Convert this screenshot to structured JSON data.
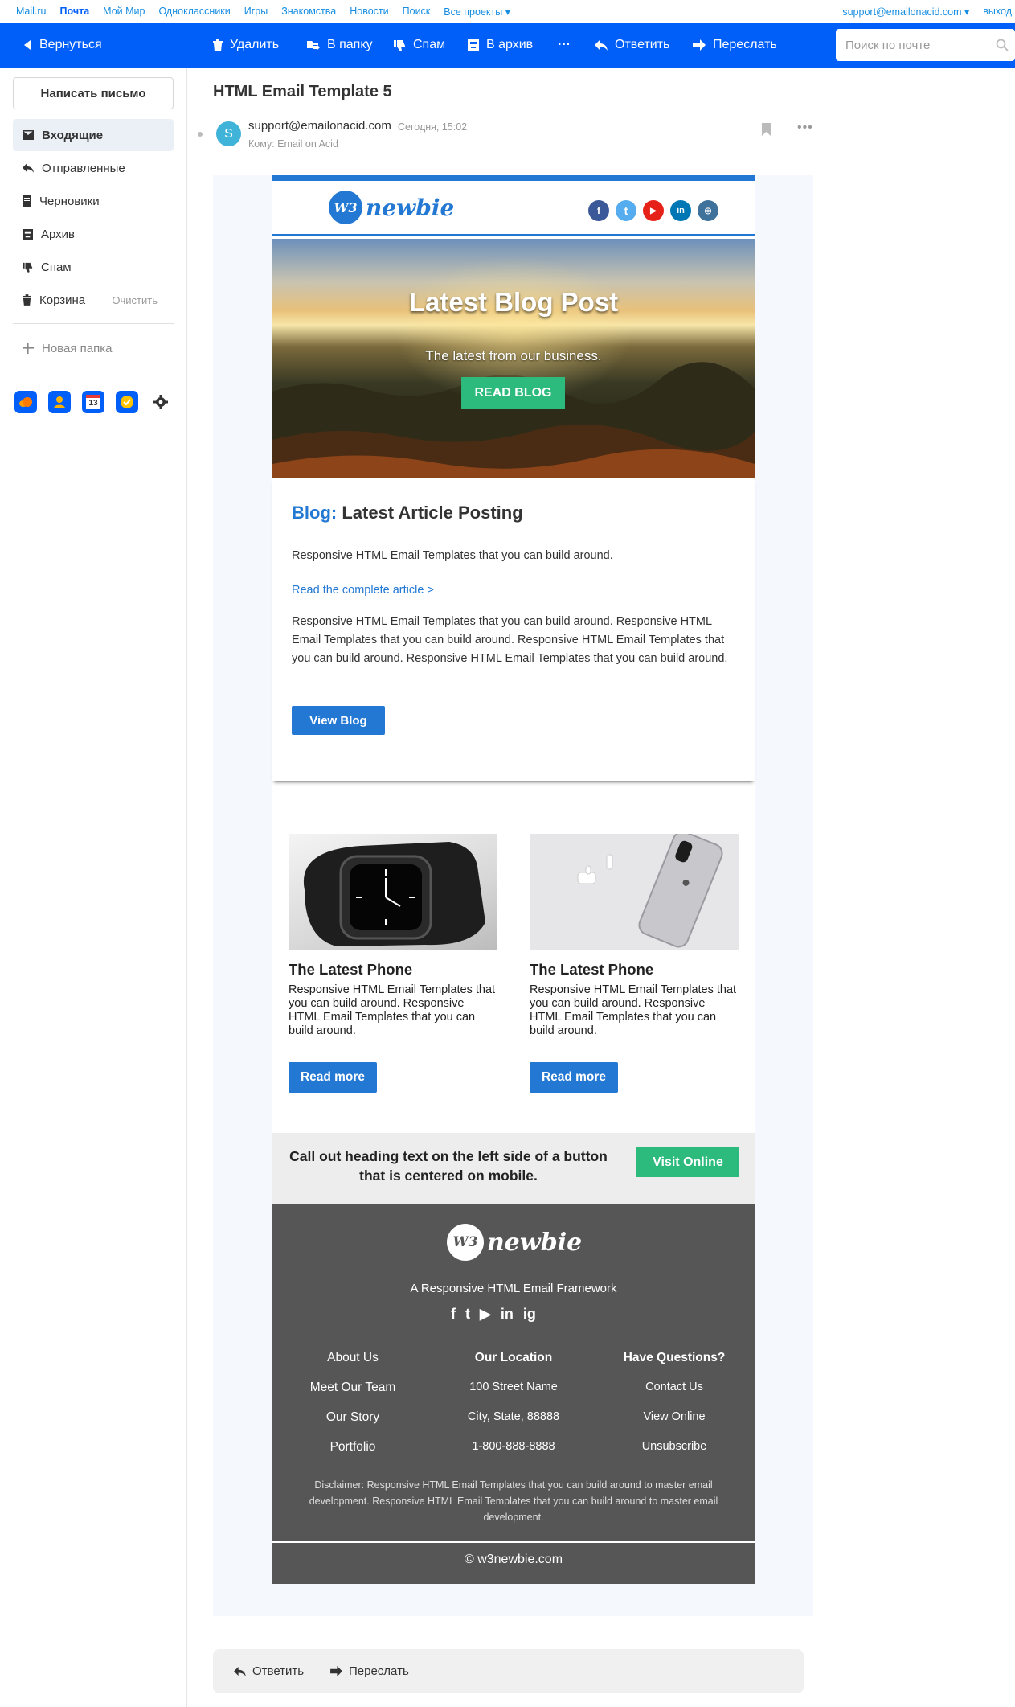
{
  "topnav": {
    "links": [
      "Mail.ru",
      "Почта",
      "Мой Мир",
      "Одноклассники",
      "Игры",
      "Знакомства",
      "Новости",
      "Поиск",
      "Все проекты ▾"
    ],
    "account": "support@emailonacid.com ▾",
    "logout": "выход"
  },
  "toolbar": {
    "back": "Вернуться",
    "delete": "Удалить",
    "to_folder": "В папку",
    "spam": "Спам",
    "archive": "В архив",
    "more": "···",
    "reply": "Ответить",
    "forward": "Переслать",
    "search_placeholder": "Поиск по почте"
  },
  "sidebar": {
    "compose": "Написать письмо",
    "folders": [
      {
        "label": "Входящие",
        "icon": "envelope-icon"
      },
      {
        "label": "Отправленные",
        "icon": "reply-icon"
      },
      {
        "label": "Черновики",
        "icon": "draft-icon"
      },
      {
        "label": "Архив",
        "icon": "archive-icon"
      },
      {
        "label": "Спам",
        "icon": "thumb-down-icon"
      },
      {
        "label": "Корзина",
        "icon": "trash-icon"
      }
    ],
    "clear": "Очистить",
    "new_folder": "Новая папка",
    "calendar_day": "13"
  },
  "message": {
    "subject": "HTML Email Template 5",
    "avatar_letter": "S",
    "from": "support@emailonacid.com",
    "date": "Сегодня, 15:02",
    "to": "Кому: Email on Acid"
  },
  "email": {
    "logo_letter": "W3",
    "logo_text": "newbie",
    "hero": {
      "title": "Latest Blog Post",
      "subtitle": "The latest from our business.",
      "button": "READ BLOG"
    },
    "blog": {
      "label": "Blog:",
      "heading": " Latest Article Posting",
      "intro": "Responsive HTML Email Templates that you can build around.",
      "link": "Read the complete article >",
      "body": "Responsive HTML Email Templates that you can build around. Responsive HTML Email Templates that you can build around. Responsive HTML Email Templates that you can build around. Responsive HTML Email Templates that you can build around.",
      "button": "View Blog"
    },
    "products": [
      {
        "title": "The Latest Phone",
        "text": "Responsive HTML Email Templates that you can build around. Responsive HTML Email Templates that you can build around.",
        "button": "Read more"
      },
      {
        "title": "The Latest Phone",
        "text": "Responsive HTML Email Templates that you can build around. Responsive HTML Email Templates that you can build around.",
        "button": "Read more"
      }
    ],
    "callout": {
      "text": "Call out heading text on the left side of a button that is centered on mobile.",
      "button": "Visit Online"
    },
    "footer": {
      "tagline": "A Responsive HTML Email Framework",
      "social": [
        "f",
        "t",
        "▶",
        "in",
        "ig"
      ],
      "col1": [
        "About Us",
        "Meet Our Team",
        "Our Story",
        "Portfolio"
      ],
      "col2": [
        "Our Location",
        "100 Street Name",
        "City, State, 88888",
        "1-800-888-8888"
      ],
      "col3": [
        "Have Questions?",
        "Contact Us",
        "View Online",
        "Unsubscribe"
      ],
      "disclaimer": "Disclaimer: Responsive HTML Email Templates that you can build around to master email development. Responsive HTML Email Templates that you can build around to master email development.",
      "copyright": "© w3newbie.com"
    }
  },
  "bottom": {
    "reply": "Ответить",
    "forward": "Переслать"
  },
  "colors": {
    "accent": "#005ff9",
    "email_blue": "#2378d3",
    "email_green": "#2dba7d",
    "footer_bg": "#565656"
  }
}
